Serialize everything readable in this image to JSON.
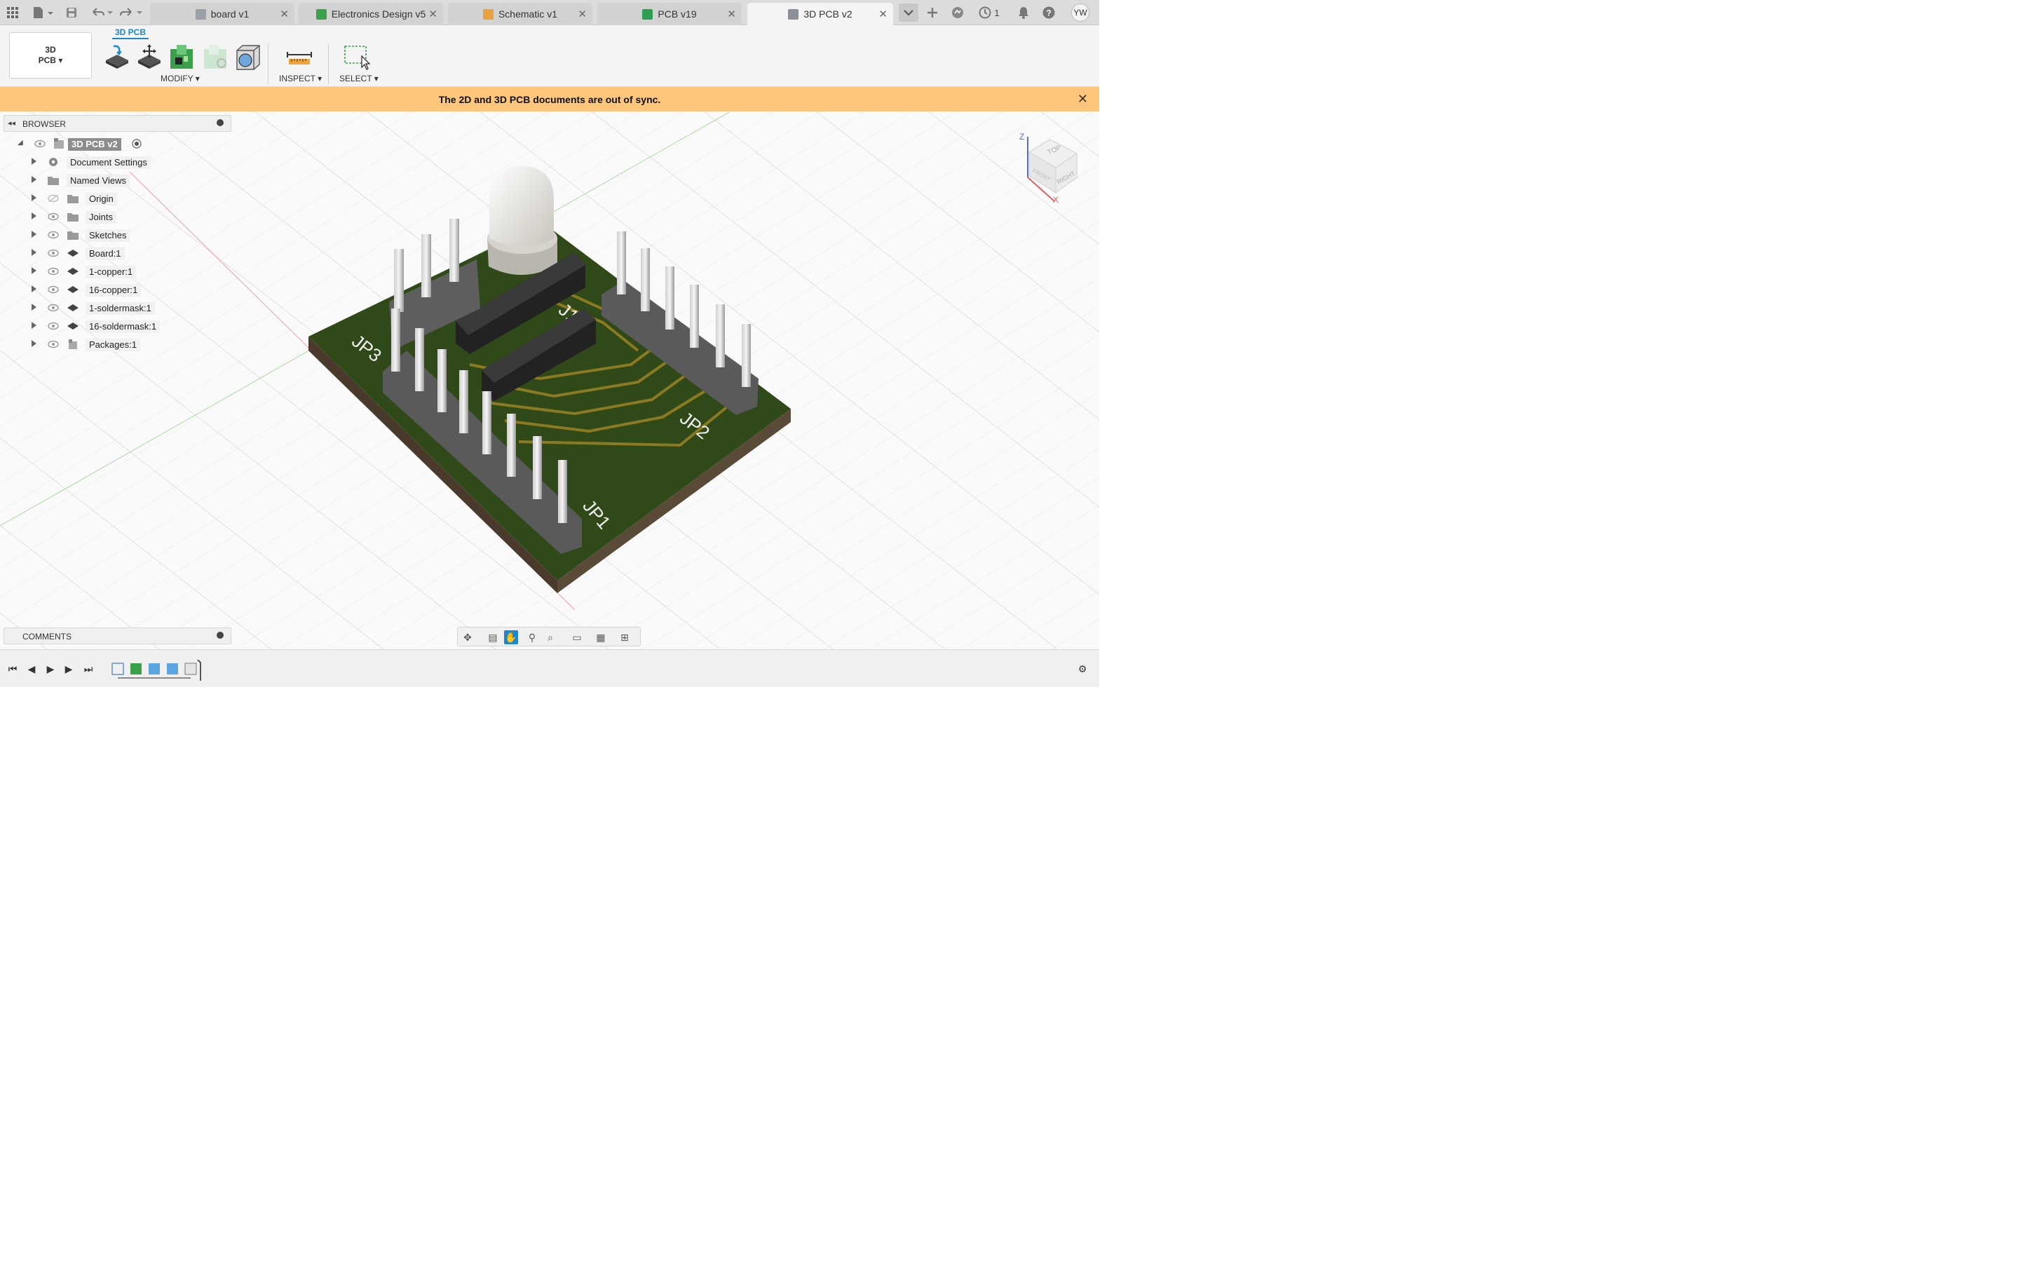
{
  "tabs": [
    {
      "label": "board v1",
      "icon_color": "#9aa0a8",
      "active": false
    },
    {
      "label": "Electronics Design v5",
      "icon_color": "#3aa14a",
      "active": false
    },
    {
      "label": "Schematic v1",
      "icon_color": "#e9a23b",
      "active": false
    },
    {
      "label": "PCB v19",
      "icon_color": "#2f9e55",
      "active": false
    },
    {
      "label": "3D PCB v2",
      "icon_color": "#8a9099",
      "active": true
    }
  ],
  "tabbar": {
    "jobs_count": "1",
    "user_initials": "YW",
    "close_glyph": "✕"
  },
  "toolbar": {
    "workspace_line1": "3D",
    "workspace_line2": "PCB",
    "workspace_tab": "3D PCB",
    "modify_label": "MODIFY ▾",
    "inspect_label": "INSPECT ▾",
    "select_label": "SELECT ▾"
  },
  "banner": {
    "message": "The 2D and 3D PCB documents are out of sync.",
    "close_glyph": "✕"
  },
  "browser": {
    "title": "BROWSER",
    "root_label": "3D PCB v2",
    "items": [
      {
        "label": "Document Settings",
        "icon": "gear-icon",
        "eye": "none"
      },
      {
        "label": "Named Views",
        "icon": "folder-icon",
        "eye": "none"
      },
      {
        "label": "Origin",
        "icon": "folder-icon",
        "eye": "hidden"
      },
      {
        "label": "Joints",
        "icon": "folder-icon",
        "eye": "visible"
      },
      {
        "label": "Sketches",
        "icon": "folder-icon",
        "eye": "visible"
      },
      {
        "label": "Board:1",
        "icon": "layer-icon",
        "eye": "visible"
      },
      {
        "label": "1-copper:1",
        "icon": "layer-icon",
        "eye": "visible"
      },
      {
        "label": "16-copper:1",
        "icon": "layer-icon",
        "eye": "visible"
      },
      {
        "label": "1-soldermask:1",
        "icon": "layer-icon",
        "eye": "visible"
      },
      {
        "label": "16-soldermask:1",
        "icon": "layer-icon",
        "eye": "visible"
      },
      {
        "label": "Packages:1",
        "icon": "component-icon",
        "eye": "visible"
      }
    ]
  },
  "comments": {
    "title": "COMMENTS"
  },
  "viewcube": {
    "top": "TOP",
    "front": "FRONT",
    "right": "RIGHT",
    "axis_z": "Z",
    "axis_x": "X"
  },
  "board_labels": {
    "jp1": "JP1",
    "jp2": "JP2",
    "jp3": "JP3",
    "j1": "J1"
  }
}
